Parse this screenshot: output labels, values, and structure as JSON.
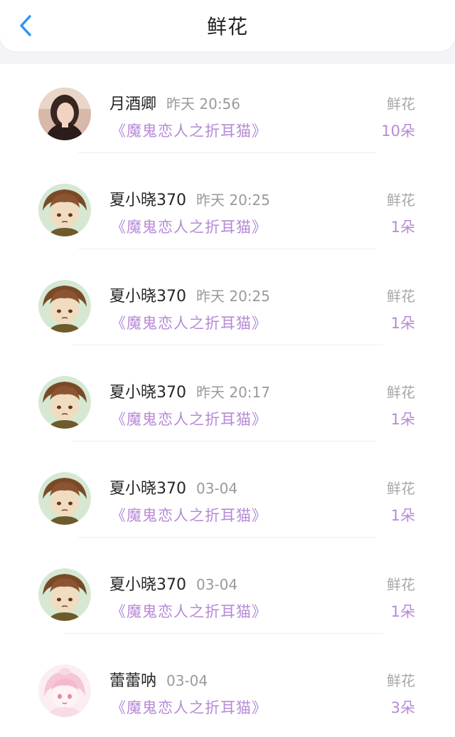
{
  "header": {
    "title": "鲜花",
    "back_icon": "chevron-left-icon",
    "accent": "#2f95f2"
  },
  "colors": {
    "link_purple": "#b58ad6",
    "muted_gray": "#9a9a9a"
  },
  "records": [
    {
      "user": "月酒卿",
      "time": "昨天 20:56",
      "book": "《魔鬼恋人之折耳猫》",
      "type": "鲜花",
      "count": "10朵",
      "avatar": "photo-avatar"
    },
    {
      "user": "夏小晓370",
      "time": "昨天 20:25",
      "book": "《魔鬼恋人之折耳猫》",
      "type": "鲜花",
      "count": "1朵",
      "avatar": "anime-boy-avatar"
    },
    {
      "user": "夏小晓370",
      "time": "昨天 20:25",
      "book": "《魔鬼恋人之折耳猫》",
      "type": "鲜花",
      "count": "1朵",
      "avatar": "anime-boy-avatar"
    },
    {
      "user": "夏小晓370",
      "time": "昨天 20:17",
      "book": "《魔鬼恋人之折耳猫》",
      "type": "鲜花",
      "count": "1朵",
      "avatar": "anime-boy-avatar"
    },
    {
      "user": "夏小晓370",
      "time": "03-04",
      "book": "《魔鬼恋人之折耳猫》",
      "type": "鲜花",
      "count": "1朵",
      "avatar": "anime-boy-avatar"
    },
    {
      "user": "夏小晓370",
      "time": "03-04",
      "book": "《魔鬼恋人之折耳猫》",
      "type": "鲜花",
      "count": "1朵",
      "avatar": "anime-boy-avatar"
    },
    {
      "user": "蕾蕾呐",
      "time": "03-04",
      "book": "《魔鬼恋人之折耳猫》",
      "type": "鲜花",
      "count": "3朵",
      "avatar": "anime-girl-avatar"
    }
  ]
}
